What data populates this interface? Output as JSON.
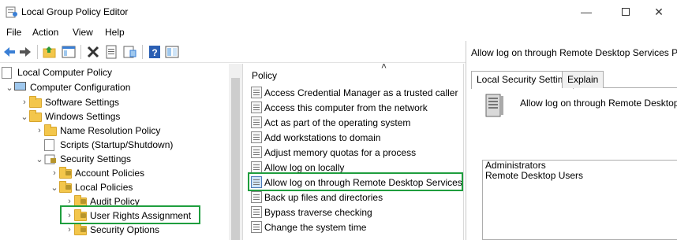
{
  "window": {
    "title": "Local Group Policy Editor",
    "controls": [
      "minimize-icon",
      "maximize-icon",
      "close-icon"
    ]
  },
  "menu": {
    "items": [
      "File",
      "Action",
      "View",
      "Help"
    ]
  },
  "toolbar": {
    "buttons": [
      "back-icon",
      "forward-icon",
      "up-folder-icon",
      "show-hide-tree-icon",
      "delete-icon",
      "properties-icon",
      "export-list-icon",
      "help-icon",
      "filter-view-icon"
    ]
  },
  "tree": {
    "items": [
      {
        "label": "Local Computer Policy",
        "icon": "policy-root-icon"
      },
      {
        "label": "Computer Configuration",
        "icon": "computer-icon"
      },
      {
        "label": "Software Settings",
        "icon": "folder-icon"
      },
      {
        "label": "Windows Settings",
        "icon": "folder-icon"
      },
      {
        "label": "Name Resolution Policy",
        "icon": "folder-icon"
      },
      {
        "label": "Scripts (Startup/Shutdown)",
        "icon": "script-icon"
      },
      {
        "label": "Security Settings",
        "icon": "security-icon"
      },
      {
        "label": "Account Policies",
        "icon": "locked-folder-icon"
      },
      {
        "label": "Local Policies",
        "icon": "locked-folder-icon"
      },
      {
        "label": "Audit Policy",
        "icon": "locked-folder-icon"
      },
      {
        "label": "User Rights Assignment",
        "icon": "locked-folder-icon"
      },
      {
        "label": "Security Options",
        "icon": "locked-folder-icon"
      }
    ]
  },
  "policy_list": {
    "header": "Policy",
    "items": [
      "Access Credential Manager as a trusted caller",
      "Access this computer from the network",
      "Act as part of the operating system",
      "Add workstations to domain",
      "Adjust memory quotas for a process",
      "Allow log on locally",
      "Allow log on through Remote Desktop Services",
      "Back up files and directories",
      "Bypass traverse checking",
      "Change the system time"
    ]
  },
  "properties": {
    "title": "Allow log on through Remote Desktop Services P",
    "tabs": [
      "Local Security Setting",
      "Explain"
    ],
    "description": "Allow log on through Remote Desktop",
    "members": [
      "Administrators",
      "Remote Desktop Users"
    ]
  },
  "colors": {
    "highlight": "#1f9e3e",
    "folder": "#f3c64b"
  }
}
